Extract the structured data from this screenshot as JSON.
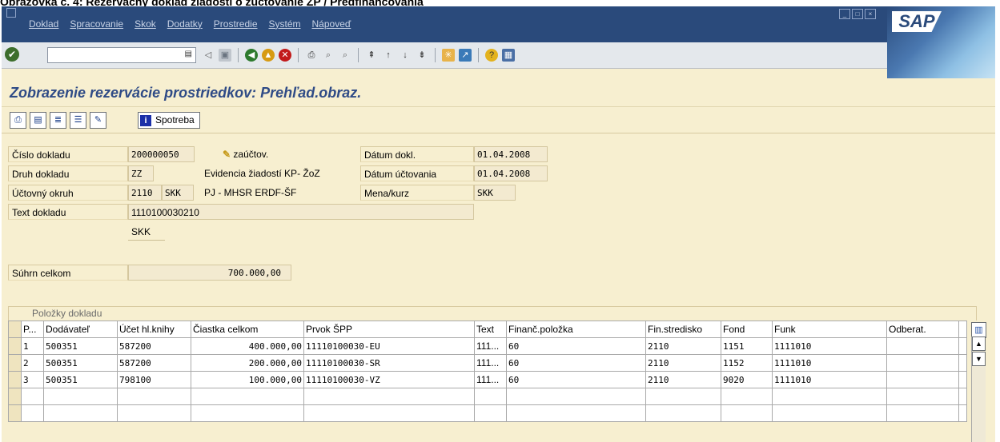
{
  "caption": "Obrazovka č. 4: Rezervačný doklad žiadosti o zúčtovanie ZP / Predfinancovania",
  "menu": [
    "Doklad",
    "Spracovanie",
    "Skok",
    "Dodatky",
    "Prostredie",
    "Systém",
    "Nápoveď"
  ],
  "brand": "SAP",
  "screen_title": "Zobrazenie rezervácie prostriedkov: Prehľad.obraz.",
  "app_toolbar": {
    "spotreba_label": "Spotreba"
  },
  "header": {
    "cislo_dokladu_label": "Číslo dokladu",
    "cislo_dokladu": "200000050",
    "status": "zaúčtov.",
    "datum_dokl_label": "Dátum dokl.",
    "datum_dokl": "01.04.2008",
    "druh_dokladu_label": "Druh dokladu",
    "druh_dokladu": "ZZ",
    "druh_dokladu_text": "Evidencia žiadostí KP- ŽoZ",
    "datum_uctovania_label": "Dátum účtovania",
    "datum_uctovania": "01.04.2008",
    "uctovny_okruh_label": "Účtovný okruh",
    "uctovny_okruh": "2110",
    "uctovny_okruh_mena": "SKK",
    "uctovny_okruh_text": "PJ - MHSR ERDF-ŠF",
    "mena_kurz_label": "Mena/kurz",
    "mena": "SKK",
    "text_dokladu_label": "Text dokladu",
    "text_dokladu": "1110100030210",
    "currency": "SKK",
    "suhrn_label": "Súhrn celkom",
    "suhrn": "700.000,00"
  },
  "table": {
    "title": "Položky dokladu",
    "columns": [
      "P...",
      "Dodávateľ",
      "Účet hl.knihy",
      "Čiastka celkom",
      "Prvok ŠPP",
      "Text",
      "Finanč.položka",
      "Fin.stredisko",
      "Fond",
      "Funk",
      "Odberat."
    ],
    "rows": [
      [
        "1",
        "500351",
        "587200",
        "400.000,00",
        "11110100030-EU",
        "111...",
        "60",
        "2110",
        "1151",
        "1111010",
        ""
      ],
      [
        "2",
        "500351",
        "587200",
        "200.000,00",
        "11110100030-SR",
        "111...",
        "60",
        "2110",
        "1152",
        "1111010",
        ""
      ],
      [
        "3",
        "500351",
        "798100",
        "100.000,00",
        "11110100030-VZ",
        "111...",
        "60",
        "2110",
        "9020",
        "1111010",
        ""
      ]
    ]
  }
}
